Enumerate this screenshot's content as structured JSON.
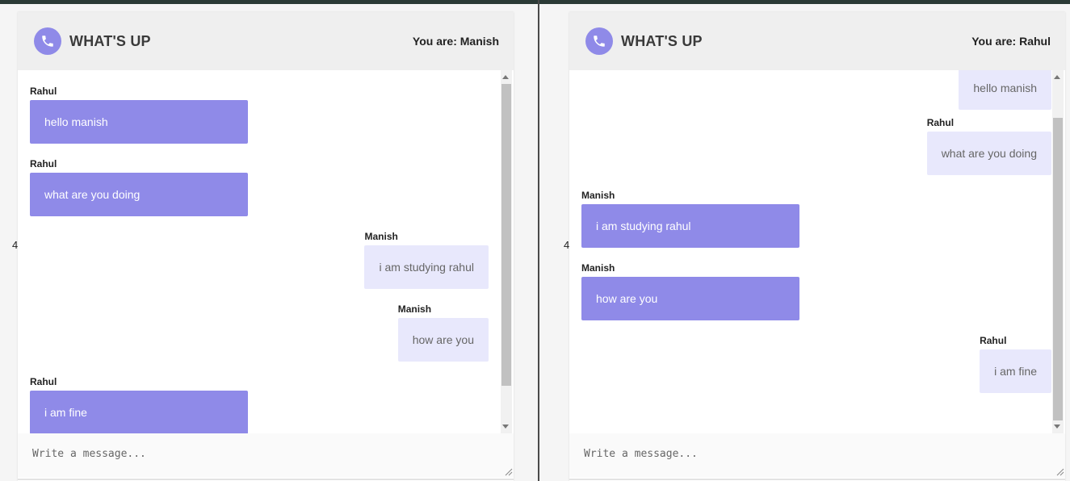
{
  "stray_glyph": "4",
  "panes": [
    {
      "app_title": "WHAT'S UP",
      "you_are": "You are: Manish",
      "placeholder": "Write a message...",
      "messages": [
        {
          "sender": "Rahul",
          "text": "hello manish",
          "mine": false
        },
        {
          "sender": "Rahul",
          "text": "what are you doing",
          "mine": false
        },
        {
          "sender": "Manish",
          "text": "i am studying rahul",
          "mine": true
        },
        {
          "sender": "Manish",
          "text": "how are you",
          "mine": true
        },
        {
          "sender": "Rahul",
          "text": "i am fine",
          "mine": false
        }
      ]
    },
    {
      "app_title": "WHAT'S UP",
      "you_are": "You are: Rahul",
      "placeholder": "Write a message...",
      "messages": [
        {
          "sender": "",
          "text": "hello manish",
          "mine": true
        },
        {
          "sender": "Rahul",
          "text": "what are you doing",
          "mine": true
        },
        {
          "sender": "Manish",
          "text": "i am studying rahul",
          "mine": false
        },
        {
          "sender": "Manish",
          "text": "how are you",
          "mine": false
        },
        {
          "sender": "Rahul",
          "text": "i am fine",
          "mine": true
        }
      ]
    }
  ],
  "colors": {
    "accent": "#8f8ae8",
    "own_bubble": "#e8e8fc",
    "header_bg": "#efefef"
  },
  "icons": {
    "header_icon": "phone-icon"
  }
}
